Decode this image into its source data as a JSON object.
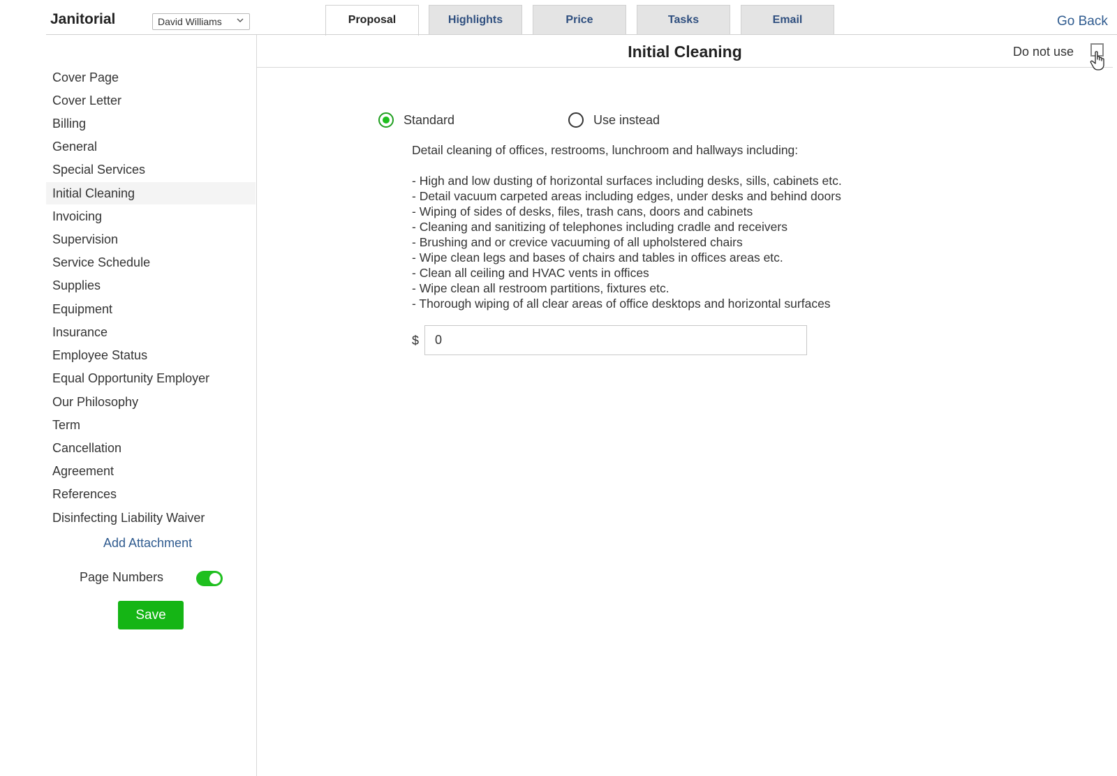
{
  "header": {
    "app_title": "Janitorial",
    "user_select": "David Williams",
    "go_back": "Go Back"
  },
  "tabs": [
    {
      "label": "Proposal",
      "active": true
    },
    {
      "label": "Highlights",
      "active": false
    },
    {
      "label": "Price",
      "active": false
    },
    {
      "label": "Tasks",
      "active": false
    },
    {
      "label": "Email",
      "active": false
    }
  ],
  "sidebar": {
    "items": [
      {
        "label": "Cover Page"
      },
      {
        "label": "Cover Letter"
      },
      {
        "label": "Billing"
      },
      {
        "label": "General"
      },
      {
        "label": "Special Services"
      },
      {
        "label": "Initial Cleaning",
        "active": true
      },
      {
        "label": "Invoicing"
      },
      {
        "label": "Supervision"
      },
      {
        "label": "Service Schedule"
      },
      {
        "label": "Supplies"
      },
      {
        "label": "Equipment"
      },
      {
        "label": "Insurance"
      },
      {
        "label": "Employee Status"
      },
      {
        "label": "Equal Opportunity Employer"
      },
      {
        "label": "Our Philosophy"
      },
      {
        "label": "Term"
      },
      {
        "label": "Cancellation"
      },
      {
        "label": "Agreement"
      },
      {
        "label": "References"
      },
      {
        "label": "Disinfecting Liability Waiver"
      }
    ],
    "add_attachment": "Add Attachment",
    "page_numbers_label": "Page Numbers",
    "page_numbers_on": true,
    "save_label": "Save"
  },
  "main": {
    "title": "Initial Cleaning",
    "do_not_use_label": "Do not use",
    "do_not_use_checked": false,
    "options": {
      "standard": "Standard",
      "use_instead": "Use instead",
      "selected": "standard"
    },
    "description_intro": "Detail cleaning of offices, restrooms, lunchroom and hallways including:",
    "description_items": [
      "- High and low dusting of horizontal surfaces including desks, sills, cabinets etc.",
      "- Detail vacuum carpeted areas including edges, under desks and behind doors",
      "- Wiping of sides of desks, files, trash cans, doors and cabinets",
      "- Cleaning and sanitizing of telephones including cradle and receivers",
      "- Brushing and or crevice vacuuming of all upholstered chairs",
      "- Wipe clean legs and bases of chairs and tables in offices areas etc.",
      "- Clean all ceiling and HVAC vents in offices",
      "- Wipe clean all restroom partitions, fixtures etc.",
      "- Thorough wiping of all clear areas of office desktops and horizontal surfaces"
    ],
    "currency_symbol": "$",
    "price_value": "0"
  },
  "colors": {
    "accent_green": "#1fbf1f",
    "link_blue": "#2f5b8f",
    "tab_text": "#2f4f7f"
  }
}
